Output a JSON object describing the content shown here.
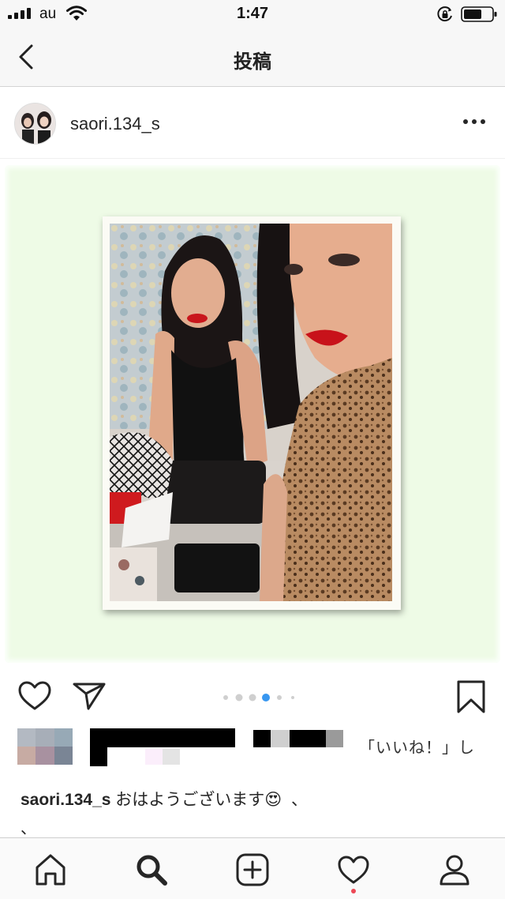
{
  "status_bar": {
    "carrier": "au",
    "time": "1:47",
    "icons": [
      "signal-icon",
      "wifi-icon",
      "orientation-lock-icon",
      "battery-icon"
    ]
  },
  "header": {
    "title": "投稿",
    "back_icon": "chevron-left-icon"
  },
  "post": {
    "username": "saori.134_s",
    "more_icon": "more-horizontal-icon",
    "carousel": {
      "total": 6,
      "active_index": 3
    },
    "likes_text": "「いいね！」し",
    "caption": {
      "username": "saori.134_s",
      "text": "おはようございます",
      "emoji": "😍",
      "suffix": "、",
      "continuation": "、"
    }
  },
  "actions": [
    "heart-icon",
    "send-icon",
    "bookmark-icon"
  ],
  "tab_bar": {
    "tabs": [
      "home-icon",
      "search-icon",
      "add-icon",
      "activity-icon",
      "profile-icon"
    ],
    "active": "search-icon",
    "notification_on": "activity-icon"
  },
  "colors": {
    "bar_bg": "#f7f7f7",
    "photo_mat": "#eefbe6",
    "dot_active": "#3897f0",
    "notification": "#ed4956"
  }
}
